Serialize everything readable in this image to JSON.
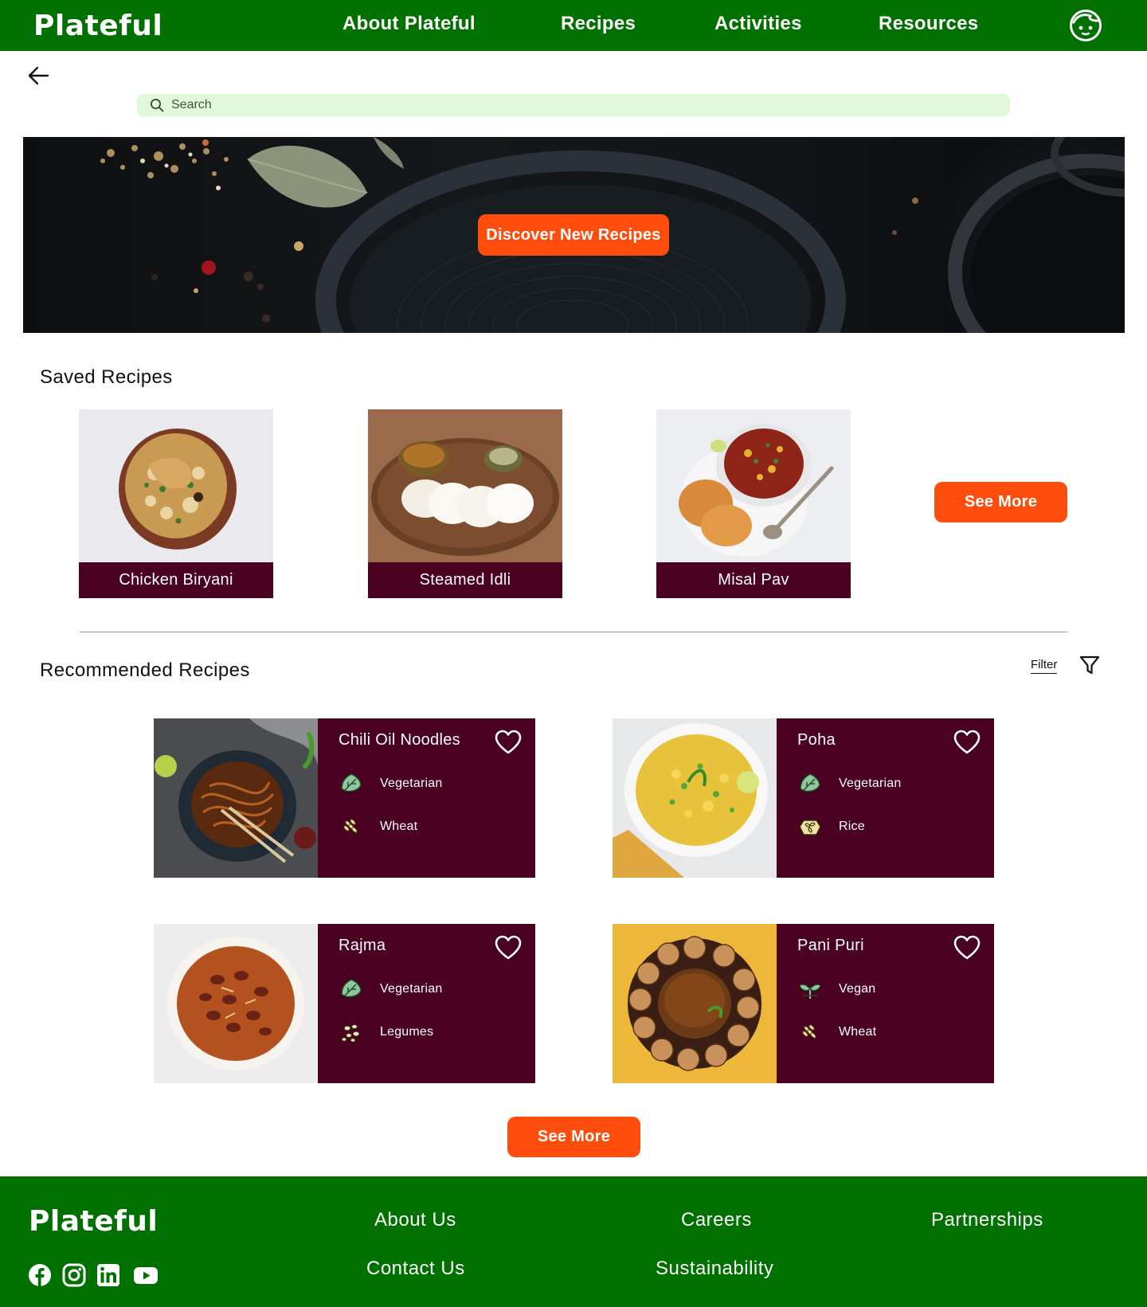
{
  "header": {
    "logo": "Plateful",
    "nav": [
      "About Plateful",
      "Recipes",
      "Activities",
      "Resources"
    ],
    "profile_icon": "face-icon"
  },
  "search": {
    "placeholder": "Search",
    "value": ""
  },
  "hero": {
    "button_label": "Discover New Recipes"
  },
  "saved": {
    "title": "Saved Recipes",
    "items": [
      {
        "name": "Chicken Biryani"
      },
      {
        "name": "Steamed Idli"
      },
      {
        "name": "Misal Pav"
      }
    ],
    "see_more_label": "See More"
  },
  "recommended": {
    "title": "Recommended Recipes",
    "filter_label": "Filter",
    "items": [
      {
        "name": "Chili Oil Noodles",
        "tags": [
          {
            "label": "Vegetarian",
            "icon": "leaf-icon"
          },
          {
            "label": "Wheat",
            "icon": "wheat-icon"
          }
        ]
      },
      {
        "name": "Poha",
        "tags": [
          {
            "label": "Vegetarian",
            "icon": "leaf-icon"
          },
          {
            "label": "Rice",
            "icon": "rice-icon"
          }
        ]
      },
      {
        "name": "Rajma",
        "tags": [
          {
            "label": "Vegetarian",
            "icon": "leaf-icon"
          },
          {
            "label": "Legumes",
            "icon": "legumes-icon"
          }
        ]
      },
      {
        "name": "Pani Puri",
        "tags": [
          {
            "label": "Vegan",
            "icon": "sprout-icon"
          },
          {
            "label": "Wheat",
            "icon": "wheat-icon"
          }
        ]
      }
    ],
    "see_more_label": "See More"
  },
  "footer": {
    "logo": "Plateful",
    "links": [
      "About Us",
      "Careers",
      "Partnerships",
      "Contact Us",
      "Sustainability"
    ],
    "social": [
      "facebook-icon",
      "instagram-icon",
      "linkedin-icon",
      "youtube-icon"
    ]
  },
  "colors": {
    "brand_green": "#007000",
    "accent_orange": "#ff4d0d",
    "card_maroon": "#4a0020",
    "search_bg": "#e2f8db"
  }
}
